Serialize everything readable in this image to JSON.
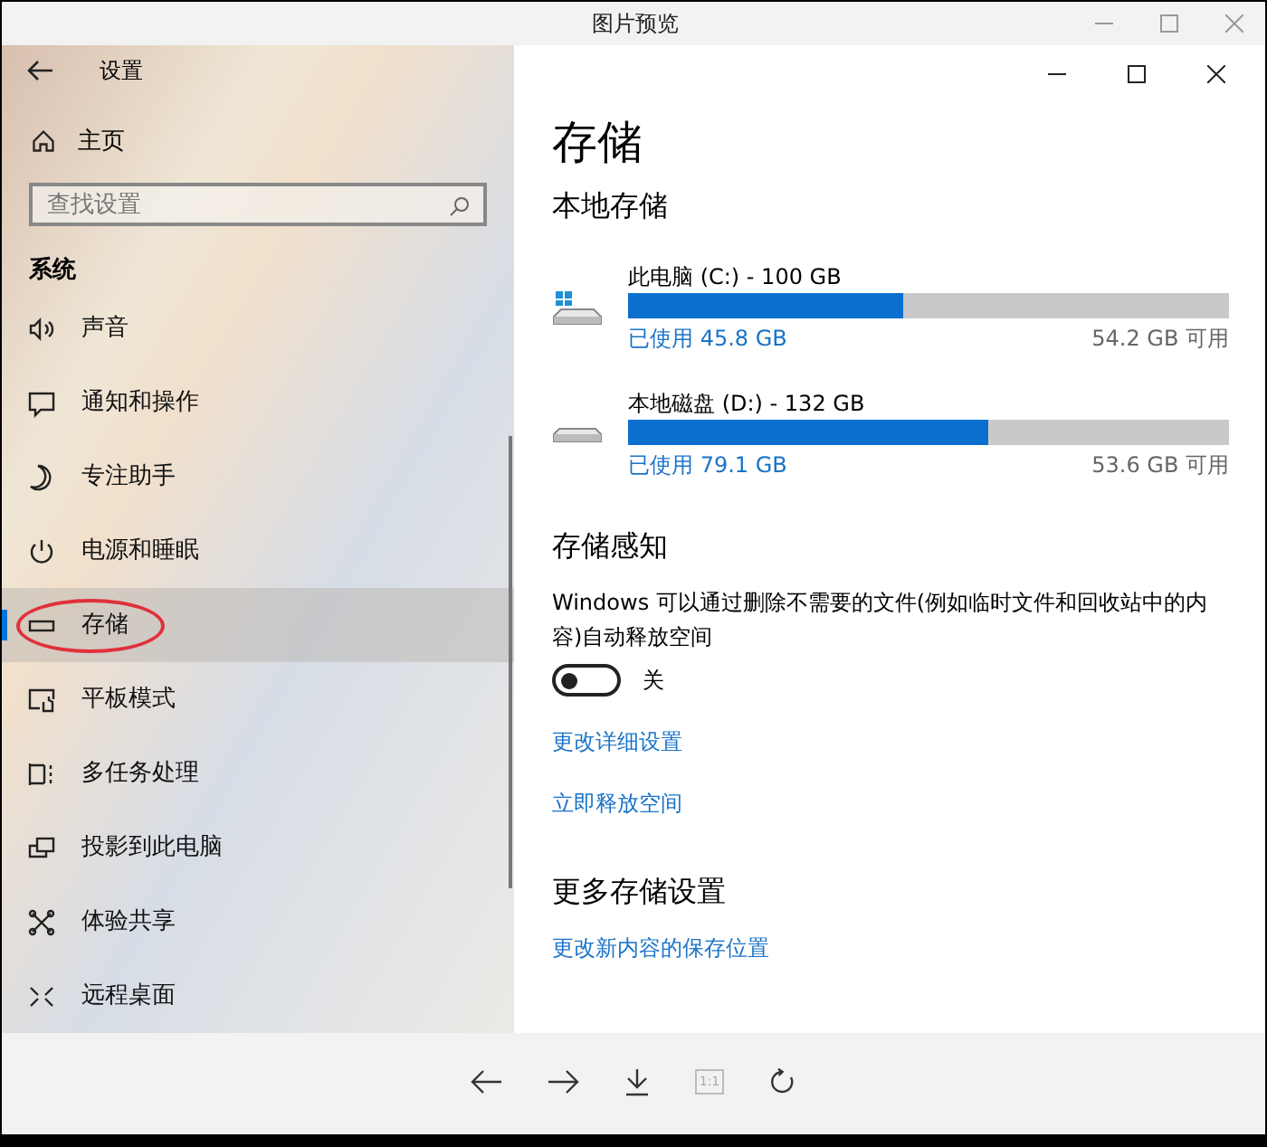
{
  "viewer": {
    "title": "图片预览"
  },
  "settings": {
    "title": "设置",
    "home": "主页",
    "search": {
      "placeholder": "查找设置"
    },
    "section": "系统",
    "items": [
      {
        "label": "声音",
        "kind": "sound",
        "selected": false,
        "circled": false
      },
      {
        "label": "通知和操作",
        "kind": "notify",
        "selected": false,
        "circled": false
      },
      {
        "label": "专注助手",
        "kind": "focus",
        "selected": false,
        "circled": false
      },
      {
        "label": "电源和睡眠",
        "kind": "power",
        "selected": false,
        "circled": false
      },
      {
        "label": "存储",
        "kind": "storage",
        "selected": true,
        "circled": true
      },
      {
        "label": "平板模式",
        "kind": "tablet",
        "selected": false,
        "circled": false
      },
      {
        "label": "多任务处理",
        "kind": "multitask",
        "selected": false,
        "circled": false
      },
      {
        "label": "投影到此电脑",
        "kind": "project",
        "selected": false,
        "circled": false
      },
      {
        "label": "体验共享",
        "kind": "share",
        "selected": false,
        "circled": false
      },
      {
        "label": "远程桌面",
        "kind": "remote",
        "selected": false,
        "circled": false
      }
    ]
  },
  "page": {
    "title": "存储",
    "local_heading": "本地存储",
    "drives": [
      {
        "name": "此电脑 (C:) - 100 GB",
        "kind": "system",
        "level": 0.458,
        "used": "已使用 45.8 GB",
        "free": "54.2 GB 可用"
      },
      {
        "name": "本地磁盘 (D:) - 132 GB",
        "kind": "data",
        "level": 0.599,
        "used": "已使用 79.1 GB",
        "free": "53.6 GB 可用"
      }
    ],
    "sense_heading": "存储感知",
    "sense_text": "Windows 可以通过删除不需要的文件(例如临时文件和回收站中的内容)自动释放空间",
    "toggle": {
      "on": false,
      "label": "关"
    },
    "links": [
      "更改详细设置",
      "立即释放空间"
    ],
    "more_heading": "更多存储设置",
    "more_links": [
      "更改新内容的保存位置"
    ]
  },
  "toolbar": {
    "actual_size": "1:1"
  }
}
